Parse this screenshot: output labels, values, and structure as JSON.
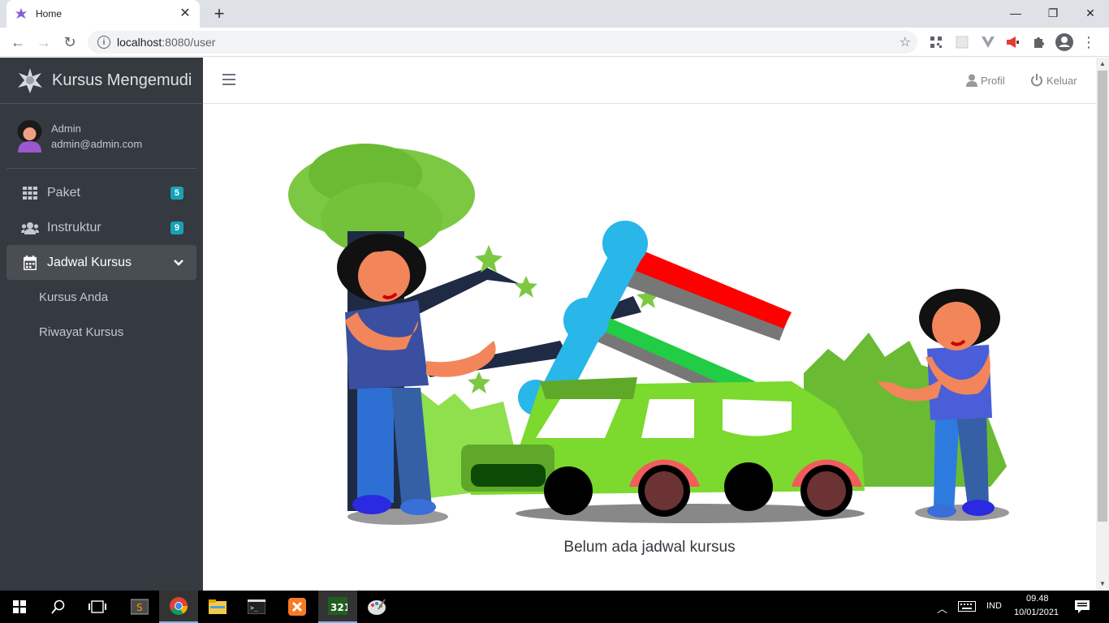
{
  "browser": {
    "tab_title": "Home",
    "url_host": "localhost",
    "url_rest": ":8080/user"
  },
  "app": {
    "brand": "Kursus Mengemudi",
    "user": {
      "name": "Admin",
      "email": "admin@admin.com"
    },
    "nav": [
      {
        "label": "Paket",
        "badge": "5",
        "icon": "grid-icon"
      },
      {
        "label": "Instruktur",
        "badge": "9",
        "icon": "users-icon"
      },
      {
        "label": "Jadwal Kursus",
        "icon": "calendar-icon",
        "active": true,
        "submenu": [
          "Kursus Anda",
          "Riwayat Kursus"
        ]
      }
    ],
    "topnav": {
      "profile_label": "Profil",
      "logout_label": "Keluar"
    },
    "empty_message": "Belum ada jadwal kursus"
  },
  "taskbar": {
    "lang": "IND",
    "time": "09.48",
    "date": "10/01/2021"
  },
  "colors": {
    "sidebar": "#343a40",
    "badge": "#17a2b8",
    "active_item": "#494e53"
  }
}
